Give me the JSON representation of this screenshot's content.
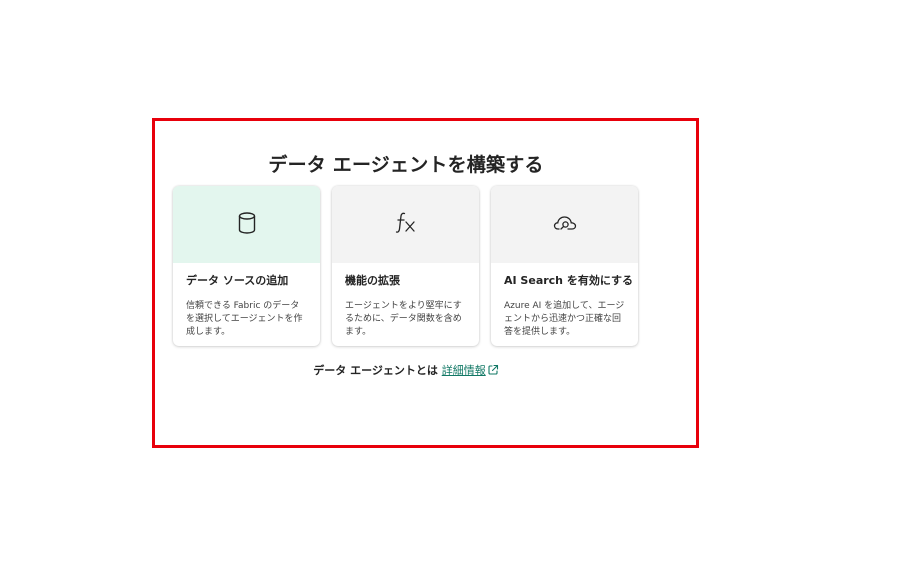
{
  "title": "データ エージェントを構築する",
  "cards": [
    {
      "icon": "database-icon",
      "title": "データ ソースの追加",
      "description": "信頼できる Fabric のデータを選択してエージェントを作成します。",
      "header_color": "#e3f6ee"
    },
    {
      "icon": "function-icon",
      "title": "機能の拡張",
      "description": "エージェントをより堅牢にするために、データ関数を含めます。",
      "header_color": "#f3f3f3"
    },
    {
      "icon": "cloud-search-icon",
      "title": "AI Search を有効にする",
      "description": "Azure AI を追加して、エージェントから迅速かつ正確な回答を提供します。",
      "header_color": "#f3f3f3"
    }
  ],
  "footer": {
    "text": "データ エージェントとは",
    "link_label": "詳細情報",
    "link_icon": "external-link-icon"
  },
  "highlight_color": "#e8000b"
}
